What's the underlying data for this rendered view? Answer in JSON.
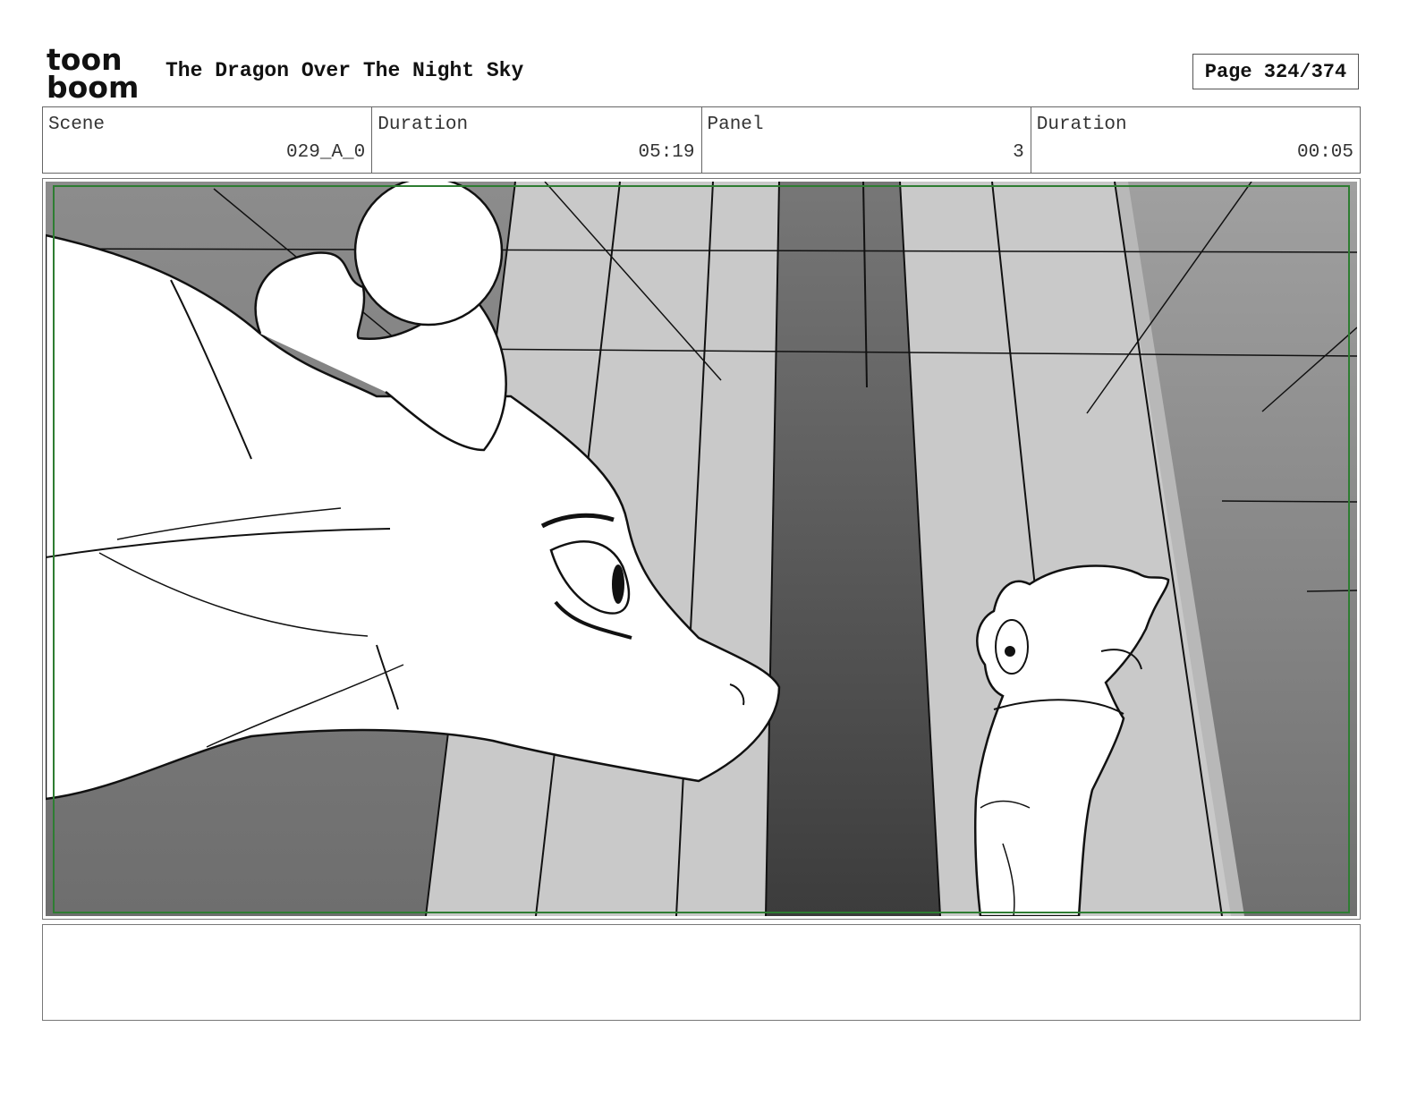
{
  "header": {
    "logo_line1": "toon",
    "logo_line2": "boom",
    "title": "The Dragon Over The Night Sky",
    "page": "Page 324/374"
  },
  "info": {
    "scene_label": "Scene",
    "scene_value": "029_A_0",
    "duration_label": "Duration",
    "duration_value": "05:19",
    "panel_label": "Panel",
    "panel_value": "3",
    "panel_duration_label": "Duration",
    "panel_duration_value": "00:05"
  },
  "notes": {
    "text": ""
  }
}
